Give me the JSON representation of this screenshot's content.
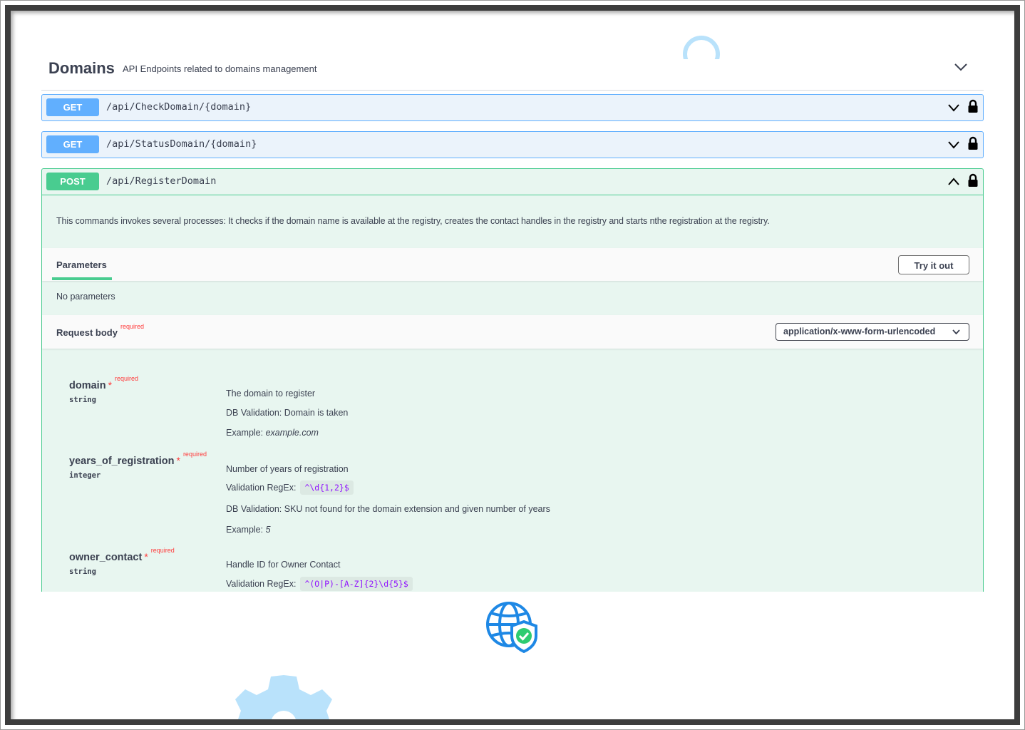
{
  "tag": {
    "title": "Domains",
    "description": "API Endpoints related to domains management",
    "chevron_icon": "chevron-down-icon"
  },
  "operations": [
    {
      "method": "GET",
      "path": "/api/CheckDomain/{domain}",
      "color": "#61affe"
    },
    {
      "method": "GET",
      "path": "/api/StatusDomain/{domain}",
      "color": "#61affe"
    },
    {
      "method": "POST",
      "path": "/api/RegisterDomain",
      "color": "#49cc90"
    }
  ],
  "post": {
    "description": "This commands invokes several processes: It checks if the domain name is available at the registry, creates the contact handles in the registry and starts nthe registration at the registry.",
    "parameters_tab": "Parameters",
    "try_button": "Try it out",
    "no_parameters": "No parameters",
    "request_body_label": "Request body",
    "required_label": "required",
    "content_type": "application/x-www-form-urlencoded"
  },
  "properties": [
    {
      "name": "domain",
      "star": "*",
      "required": "required",
      "type": "string",
      "lines": [
        "The domain to register",
        "DB Validation: Domain is taken"
      ],
      "example_label": "Example:",
      "example_value": "example.com"
    },
    {
      "name": "years_of_registration",
      "star": "*",
      "required": "required",
      "type": "integer",
      "line1": "Number of years of registration",
      "regex_label": "Validation RegEx:",
      "regex": "^\\d{1,2}$",
      "line3": "DB Validation: SKU not found for the domain extension and given number of years",
      "example_label": "Example:",
      "example_value": "5"
    },
    {
      "name": "owner_contact",
      "star": "*",
      "required": "required",
      "type": "string",
      "line1": "Handle ID for Owner Contact",
      "regex_label": "Validation RegEx:",
      "regex": "^(O|P)-[A-Z]{2}\\d{5}$"
    }
  ],
  "icons": {
    "lock": "lock-icon",
    "globe": "globe-shield-check-icon",
    "ring": "ring-decoration",
    "gear": "gear-decoration"
  },
  "colors": {
    "get": "#61affe",
    "post": "#49cc90",
    "required": "#ff3a3a",
    "regex": "#9012fe"
  }
}
